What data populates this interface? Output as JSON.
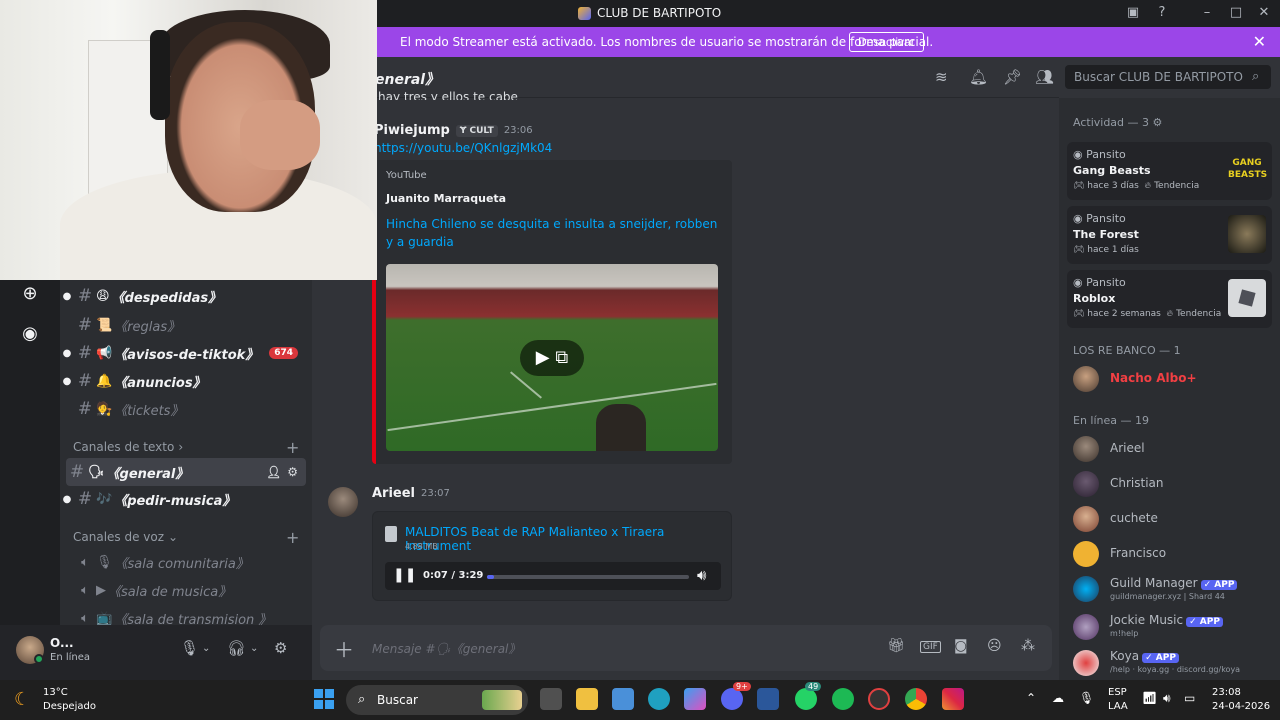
{
  "window": {
    "title": "CLUB DE BARTIPOTO"
  },
  "banner": {
    "text": "El modo Streamer está activado. Los nombres de usuario se mostrarán de forma parcial.",
    "button": "Desactivar",
    "close": "✕",
    "color": "#9b46e8"
  },
  "channels": [
    {
      "emoji": "😩",
      "name": "《despedidas》",
      "unread": true,
      "bullet": true
    },
    {
      "emoji": "📜",
      "name": "《reglas》",
      "unread": false,
      "bullet": false
    },
    {
      "emoji": "📢",
      "name": "《avisos-de-tiktok》",
      "unread": true,
      "bullet": true,
      "badge": "674"
    },
    {
      "emoji": "🔔",
      "name": "《anuncios》",
      "unread": true,
      "bullet": true
    },
    {
      "emoji": "🧑‍⚖️",
      "name": "《tickets》",
      "unread": false,
      "bullet": false
    }
  ],
  "categories": {
    "text": "Canales de texto",
    "voice": "Canales de voz"
  },
  "text_channels": [
    {
      "emoji": "🗣",
      "name": "《general》"
    },
    {
      "emoji": "🎶",
      "name": "《pedir-musica》"
    }
  ],
  "voice_channels": [
    {
      "emoji": "🎙",
      "name": "《sala comunitaria》"
    },
    {
      "emoji": "▶",
      "name": "《sala de musica》"
    },
    {
      "emoji": "📺",
      "name": "《sala de transmision 》"
    }
  ],
  "user": {
    "name": "O...",
    "status": "En línea"
  },
  "chat": {
    "channel_title": "eneral》",
    "prev_line": "hay tres y ellos te cabe",
    "msg1": {
      "author": "Piwiejump",
      "tag": "CULT",
      "time": "23:06",
      "link": "https://youtu.be/QKnlgzjMk04"
    },
    "embed": {
      "provider": "YouTube",
      "author": "Juanito Marraqueta",
      "title": "Hincha Chileno se desquita e insulta a sneijder, robben y a guardia",
      "accent": "#e60012"
    },
    "msg2": {
      "author": "Arieel",
      "time": "23:07"
    },
    "attachment": {
      "name": "MALDITOS Beat de RAP Malianteo x Tiraera Instrument",
      "size": "4.88 MB",
      "time": "0:07 / 3:29",
      "progress": 0.034
    },
    "composer_placeholder": "Mensaje #🗣《general》"
  },
  "search": {
    "placeholder": "Buscar CLUB DE BARTIPOTO"
  },
  "members": {
    "activity_header": "Actividad — 3",
    "activities": [
      {
        "user": "Pansito",
        "game": "Gang Beasts",
        "meta": "hace 3 días",
        "trend": "Tendencia"
      },
      {
        "user": "Pansito",
        "game": "The Forest",
        "meta": "hace 1 días",
        "trend": ""
      },
      {
        "user": "Pansito",
        "game": "Roblox",
        "meta": "hace 2 semanas",
        "trend": "Tendencia"
      }
    ],
    "group_header": "LOS RE BANCO — 1",
    "group_member": {
      "name": "Nacho Albo+",
      "color": "#f23f43"
    },
    "online_header": "En línea — 19",
    "online": [
      {
        "name": "Arieel",
        "sub": "",
        "app": false
      },
      {
        "name": "Christian",
        "sub": "",
        "app": false
      },
      {
        "name": "cuchete",
        "sub": "",
        "app": false
      },
      {
        "name": "Francisco",
        "sub": "",
        "app": false
      },
      {
        "name": "Guild Manager",
        "sub": "guildmanager.xyz | Shard 44",
        "app": true
      },
      {
        "name": "Jockie Music",
        "sub": "m!help",
        "app": true
      },
      {
        "name": "Koya",
        "sub": "/help · koya.gg · discord.gg/koya",
        "app": true
      }
    ],
    "app_label": "✓ APP"
  },
  "taskbar": {
    "weather_temp": "13°C",
    "weather_desc": "Despejado",
    "search": "Buscar",
    "lang1": "ESP",
    "lang2": "LAA",
    "time": "23:08",
    "date": "24-04-2026",
    "badge_discord": "9+",
    "badge_whatsapp": "49"
  }
}
